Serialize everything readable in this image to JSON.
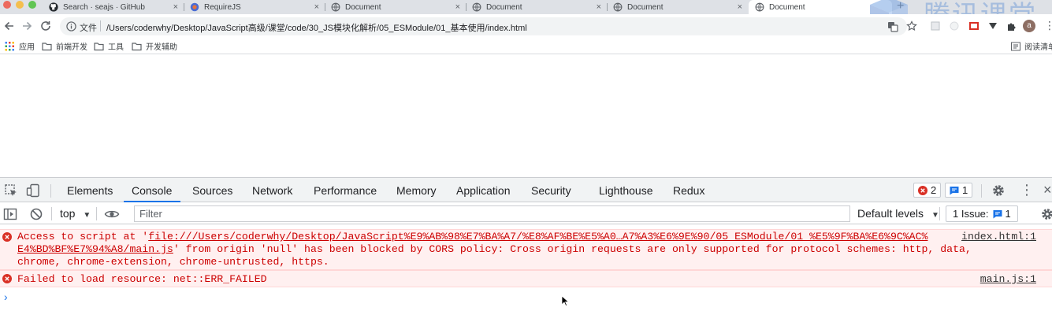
{
  "browser": {
    "tabs": [
      {
        "title": "Search · seajs · GitHub",
        "icon": "github-icon",
        "active": false
      },
      {
        "title": "RequireJS",
        "icon": "requirejs-icon",
        "active": false
      },
      {
        "title": "Document",
        "icon": "globe-icon",
        "active": false
      },
      {
        "title": "Document",
        "icon": "globe-icon",
        "active": false
      },
      {
        "title": "Document",
        "icon": "globe-icon",
        "active": false
      },
      {
        "title": "Document",
        "icon": "globe-icon",
        "active": true
      }
    ],
    "tab_close_glyph": "×",
    "new_tab_glyph": "+",
    "watermark_text": "腾讯课堂",
    "address": {
      "scheme_label": "文件",
      "url": "/Users/coderwhy/Desktop/JavaScript高级/课堂/code/30_JS模块化解析/05_ESModule/01_基本使用/index.html"
    },
    "profile_initial": "a",
    "menu_glyph": "⋮"
  },
  "bookmarks": {
    "items": [
      {
        "label": "应用",
        "icon": "apps-grid-icon"
      },
      {
        "label": "前端开发",
        "icon": "folder-icon"
      },
      {
        "label": "工具",
        "icon": "folder-icon"
      },
      {
        "label": "开发辅助",
        "icon": "folder-icon"
      }
    ],
    "reading_list": "阅读清单"
  },
  "devtools": {
    "tabs": [
      "Elements",
      "Console",
      "Sources",
      "Network",
      "Performance",
      "Memory",
      "Application",
      "Security",
      "Lighthouse",
      "Redux"
    ],
    "active_tab": "Console",
    "error_count": "2",
    "message_count": "1",
    "more_glyph": "⋮",
    "close_glyph": "×",
    "console_toolbar": {
      "context": "top",
      "dropdown_glyph": "▼",
      "filter_placeholder": "Filter",
      "levels_label": "Default levels",
      "issues_label": "1 Issue:",
      "issues_count": "1"
    },
    "messages": [
      {
        "level": "error",
        "prefix": "Access to script at '",
        "url_line1": "file:///Users/coderwhy/Desktop/JavaScript%E9%AB%98%E7%BA%A7/%E8%AF%BE%E5%A0…A7%A3%E6%9E%90/05_ESModule/01_%E5%9F%BA%E6%9C%AC%",
        "url_line2": "E4%BD%BF%E7%94%A8/main.js",
        "suffix_line2": "' from origin 'null' has been blocked by CORS policy: Cross origin requests are only supported for protocol schemes: http, data,",
        "line3": "chrome, chrome-extension, chrome-untrusted, https.",
        "source": "index.html:1"
      },
      {
        "level": "error",
        "text": "Failed to load resource: net::ERR_FAILED",
        "source": "main.js:1"
      }
    ],
    "prompt_glyph": "›"
  },
  "colors": {
    "accent": "#1a73e8",
    "error_text": "#cc0000",
    "error_bg": "#fff0f0",
    "error_icon": "#d93025",
    "tabstrip_bg": "#dee1e6"
  }
}
